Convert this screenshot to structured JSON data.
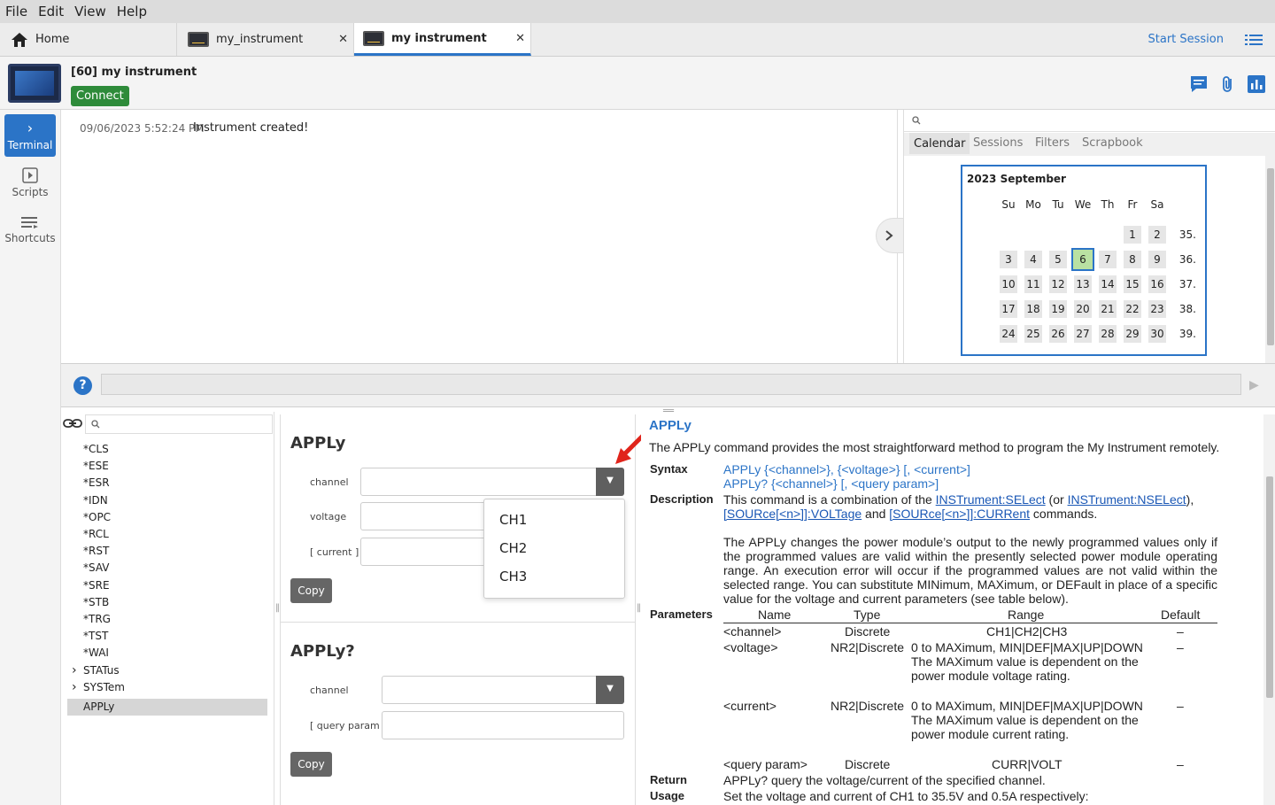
{
  "menu": [
    "File",
    "Edit",
    "View",
    "Help"
  ],
  "tabs": [
    {
      "label": "Home",
      "icon": "home-icon"
    },
    {
      "label": "my_instrument",
      "icon": "instrument-icon"
    },
    {
      "label": "my instrument",
      "icon": "instrument-icon",
      "active": true
    }
  ],
  "session": {
    "start_label": "Start Session"
  },
  "instrument": {
    "title": "[60] my instrument",
    "connect_label": "Connect"
  },
  "rail": [
    {
      "label": "Terminal",
      "icon": "chevron-right-icon",
      "active": true
    },
    {
      "label": "Scripts",
      "icon": "play-icon"
    },
    {
      "label": "Shortcuts",
      "icon": "list-icon"
    }
  ],
  "terminal": {
    "timestamp": "09/06/2023 5:52:24 PM",
    "message": "Instrument created!"
  },
  "calendar_panel": {
    "tabs": [
      "Calendar",
      "Sessions",
      "Filters",
      "Scrapbook"
    ],
    "month_label": "2023 September",
    "days_of_week": [
      "Su",
      "Mo",
      "Tu",
      "We",
      "Th",
      "Fr",
      "Sa"
    ],
    "weeks": [
      {
        "week": "35.",
        "days": [
          "",
          "",
          "",
          "",
          "",
          "1",
          "2"
        ]
      },
      {
        "week": "36.",
        "days": [
          "3",
          "4",
          "5",
          "6",
          "7",
          "8",
          "9"
        ]
      },
      {
        "week": "37.",
        "days": [
          "10",
          "11",
          "12",
          "13",
          "14",
          "15",
          "16"
        ]
      },
      {
        "week": "38.",
        "days": [
          "17",
          "18",
          "19",
          "20",
          "21",
          "22",
          "23"
        ]
      },
      {
        "week": "39.",
        "days": [
          "24",
          "25",
          "26",
          "27",
          "28",
          "29",
          "30"
        ]
      }
    ],
    "selected_day": "6",
    "selected_color": "#b9e1a2"
  },
  "tree": {
    "items": [
      "*CLS",
      "*ESE",
      "*ESR",
      "*IDN",
      "*OPC",
      "*RCL",
      "*RST",
      "*SAV",
      "*SRE",
      "*STB",
      "*TRG",
      "*TST",
      "*WAI"
    ],
    "folders": [
      "STATus",
      "SYSTem"
    ],
    "selected": "APPLy"
  },
  "form": {
    "apply": {
      "heading": "APPLy",
      "labels": [
        "channel",
        "voltage",
        "[ current ]"
      ],
      "copy_label": "Copy"
    },
    "apply_query": {
      "heading": "APPLy?",
      "labels": [
        "channel",
        "[ query param ]"
      ],
      "copy_label": "Copy"
    },
    "channel_options": [
      "CH1",
      "CH2",
      "CH3"
    ]
  },
  "doc": {
    "title": "APPLy",
    "intro": "The APPLy command provides the most straightforward method to program the My Instrument remotely.",
    "syntax_label": "Syntax",
    "syntax_1": "APPLy {<channel>}, {<voltage>} [, <current>]",
    "syntax_2": "APPLy? {<channel>} [, <query param>]",
    "description_label": "Description",
    "desc_a": "This command is a combination of the",
    "desc_link1": "INSTrument:SELect",
    "desc_or": "(or",
    "desc_link2": "INSTrument:NSELect",
    "desc_link3": "[SOURce[<n>]]:VOLTage",
    "desc_and": "and",
    "desc_link4": "[SOURce[<n>]]:CURRent",
    "desc_end": "commands.",
    "desc_p2": "The APPLy changes the power module’s output to the newly programmed values only if the programmed values are valid within the presently selected power module operating range. An execution error will occur if the programmed values are not valid within the selected range. You can substitute MINimum, MAXimum, or DEFault in place of a specific value for the voltage and current parameters (see table below).",
    "parameters_label": "Parameters",
    "param_headers": [
      "Name",
      "Type",
      "Range",
      "Default"
    ],
    "params": [
      {
        "name": "<channel>",
        "type": "Discrete",
        "range": "CH1|CH2|CH3",
        "default": "–"
      },
      {
        "name": "<voltage>",
        "type": "NR2|Discrete",
        "range": "0 to MAXimum, MIN|DEF|MAX|UP|DOWN The MAXimum value is dependent on the power module voltage rating.",
        "default": "–"
      },
      {
        "name": "<current>",
        "type": "NR2|Discrete",
        "range": "0 to MAXimum, MIN|DEF|MAX|UP|DOWN The MAXimum value is dependent on the power module current rating.",
        "default": "–"
      },
      {
        "name": "<query param>",
        "type": "Discrete",
        "range": "CURR|VOLT",
        "default": "–"
      }
    ],
    "return_label": "Return",
    "return_text": "APPLy? query the voltage/current of the specified channel.",
    "usage_label": "Usage",
    "usage_text": "Set the voltage and current of CH1 to 35.5V and 0.5A respectively:"
  },
  "colors": {
    "accent": "#2b74c7",
    "connect": "#2e8b3a",
    "arrow": "#e0241b"
  }
}
